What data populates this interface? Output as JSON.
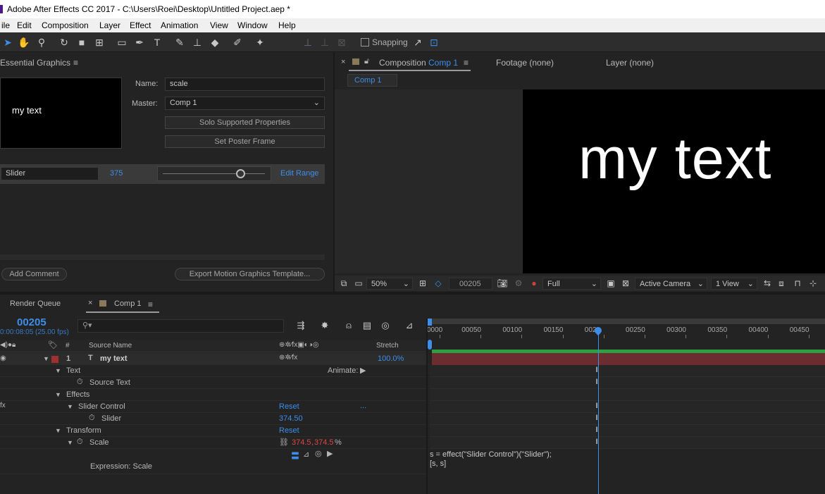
{
  "app": {
    "title": "Adobe After Effects CC 2017 - C:\\Users\\Roei\\Desktop\\Untitled Project.aep *"
  },
  "menu": [
    "ile",
    "Edit",
    "Composition",
    "Layer",
    "Effect",
    "Animation",
    "View",
    "Window",
    "Help"
  ],
  "toolbar": {
    "snapping_label": "Snapping"
  },
  "essential_graphics": {
    "panel_title": "Essential Graphics",
    "preview_text": "my text",
    "name_label": "Name:",
    "name_value": "scale",
    "master_label": "Master:",
    "master_value": "Comp 1",
    "solo_button": "Solo Supported Properties",
    "poster_button": "Set Poster Frame",
    "slider_name": "Slider",
    "slider_value": "375",
    "slider_level": 0.76,
    "edit_range": "Edit Range",
    "add_comment": "Add Comment",
    "export_button": "Export Motion Graphics Template..."
  },
  "composition_panel": {
    "tab_close": "×",
    "tab_label": "Composition",
    "tab_comp": "Comp 1",
    "footage_tab": "Footage (none)",
    "layer_tab": "Layer (none)",
    "breadcrumb": "Comp 1",
    "viewer_text": "my text",
    "zoom": "50%",
    "timecode": "00205",
    "resolution": "Full",
    "camera": "Active Camera",
    "views": "1 View"
  },
  "timeline": {
    "render_queue_tab": "Render Queue",
    "comp_tab_close": "×",
    "comp_tab": "Comp 1",
    "current_time": "00205",
    "time_sub": "0:00:08:05 (25.00 fps)",
    "search_placeholder": "",
    "header_hash": "#",
    "header_source": "Source Name",
    "header_stretch": "Stretch",
    "ruler_ticks": [
      "0000",
      "00050",
      "00100",
      "00150",
      "002",
      "00250",
      "00300",
      "00350",
      "00400",
      "00450"
    ],
    "playhead_frame": 205,
    "ruler_start": 0,
    "ruler_end": 482,
    "layer_number": "1",
    "layer_name": "my text",
    "layer_stretch": "100.0%",
    "text_group": "Text",
    "animate_label": "Animate:",
    "source_text": "Source Text",
    "effects_group": "Effects",
    "slider_control": "Slider Control",
    "reset": "Reset",
    "ellipsis": "...",
    "slider_prop": "Slider",
    "slider_prop_value": "374.50",
    "transform_group": "Transform",
    "transform_reset": "Reset",
    "scale_prop": "Scale",
    "scale_x": "374.5",
    "scale_comma": ",",
    "scale_y": "374.5",
    "scale_pct": "%",
    "expression_label": "Expression: Scale",
    "expression_line1": "s = effect(\"Slider Control\")(\"Slider\");",
    "expression_line2": "[s, s]"
  },
  "colors": {
    "accent": "#3d8ee8",
    "layer_label": "#a03030",
    "scale_value": "#e04646",
    "layer_bar": "#6b2d30",
    "work_area": "#2ea043"
  }
}
